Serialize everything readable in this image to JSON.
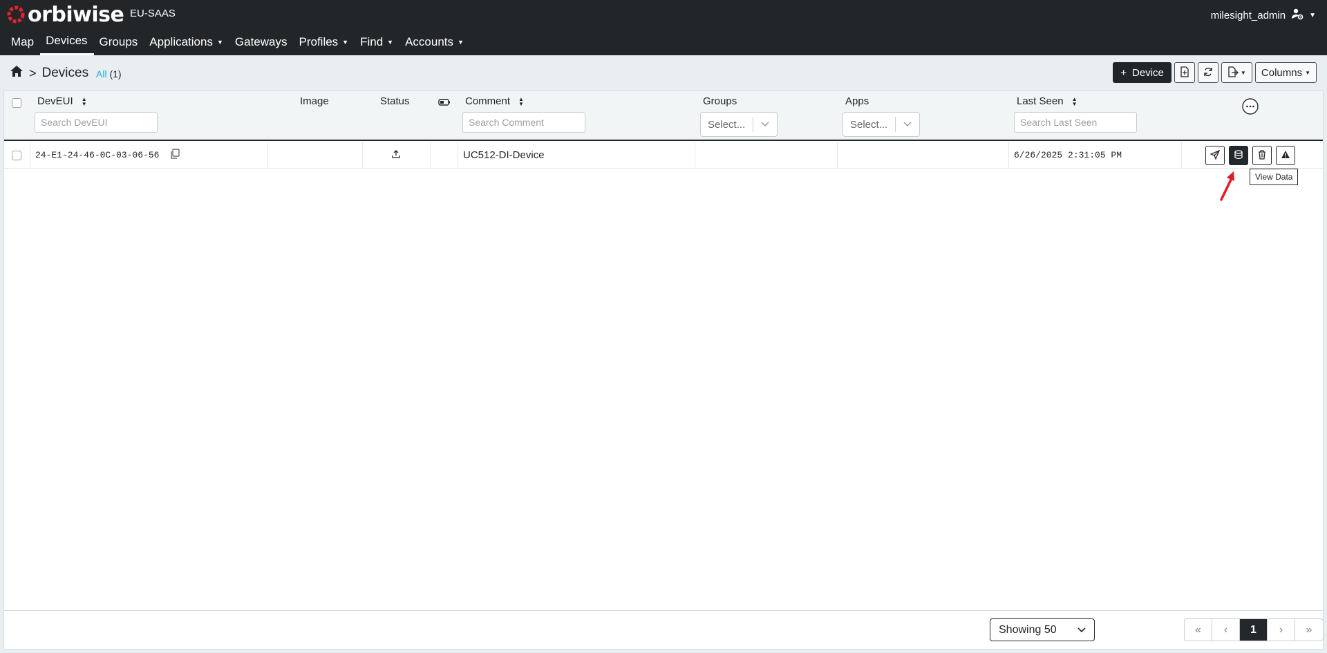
{
  "brand": {
    "name": "orbiwise",
    "tenant": "EU-SAAS"
  },
  "user": {
    "name": "milesight_admin"
  },
  "nav": [
    {
      "label": "Map"
    },
    {
      "label": "Devices"
    },
    {
      "label": "Groups"
    },
    {
      "label": "Applications"
    },
    {
      "label": "Gateways"
    },
    {
      "label": "Profiles"
    },
    {
      "label": "Find"
    },
    {
      "label": "Accounts"
    }
  ],
  "breadcrumb": {
    "title": "Devices",
    "filter": "All",
    "count": "(1)"
  },
  "toolbar": {
    "add_device": "Device",
    "columns": "Columns"
  },
  "table": {
    "headers": {
      "deveui": "DevEUI",
      "image": "Image",
      "status": "Status",
      "comment": "Comment",
      "groups": "Groups",
      "apps": "Apps",
      "last_seen": "Last Seen"
    },
    "placeholders": {
      "deveui": "Search DevEUI",
      "comment": "Search Comment",
      "groups": "Select...",
      "apps": "Select...",
      "last_seen": "Search Last Seen"
    },
    "rows": [
      {
        "deveui": "24-E1-24-46-0C-03-06-56",
        "comment": "UC512-DI-Device",
        "last_seen": "6/26/2025 2:31:05 PM"
      }
    ]
  },
  "tooltip": "View Data",
  "footer": {
    "showing": "Showing 50",
    "page": "1"
  },
  "colors": {
    "topbar": "#222629",
    "accent": "#20a8d8",
    "logo": "#e0252b"
  }
}
